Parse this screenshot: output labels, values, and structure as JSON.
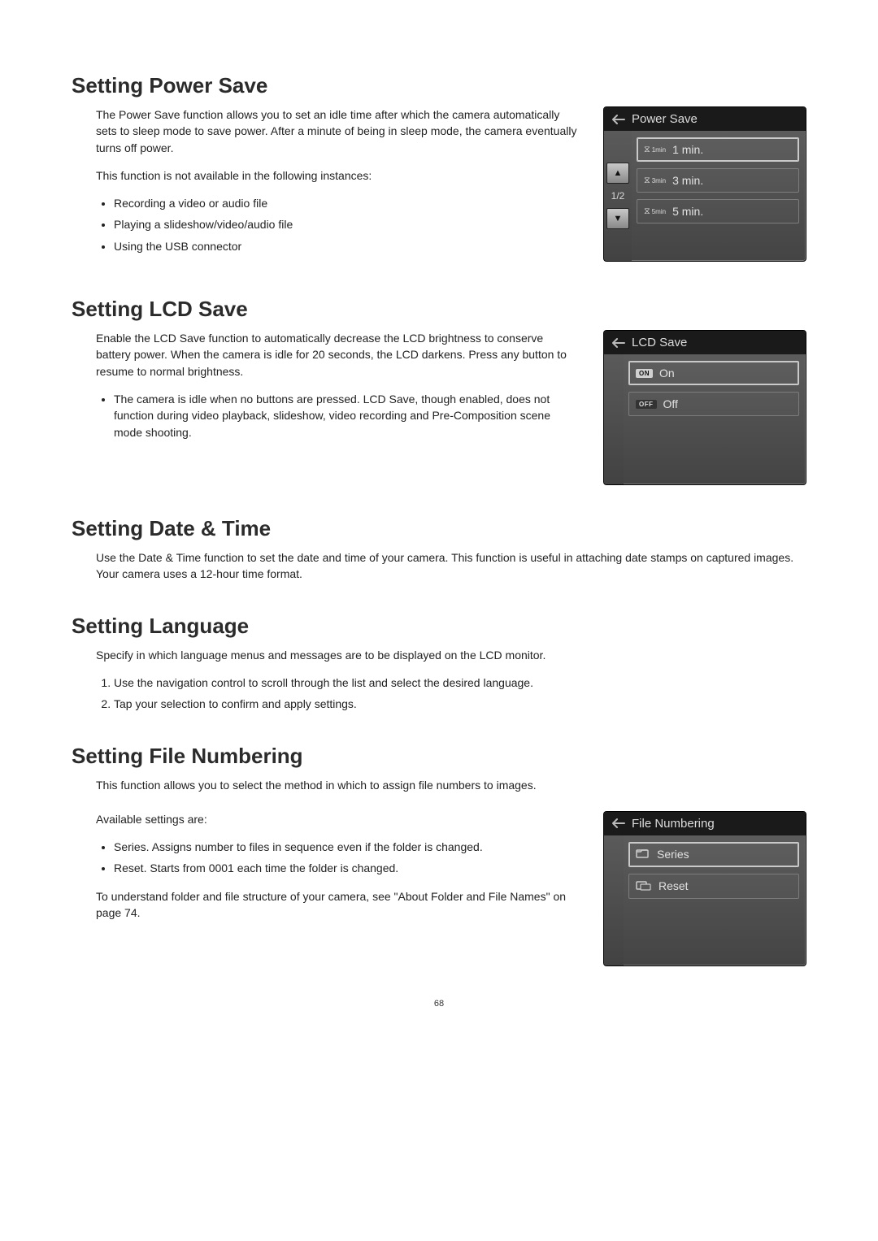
{
  "page_number": "68",
  "sections": {
    "power_save": {
      "heading": "Setting Power Save",
      "p1": "The Power Save function allows you to set an idle time after which the camera automatically sets to sleep mode to save power.  After a minute of being in sleep mode, the camera eventually turns off power.",
      "p2": "This function is not available in the following instances:",
      "bullets": [
        "Recording a video or audio file",
        "Playing a slideshow/video/audio file",
        "Using the USB connector"
      ],
      "lcd": {
        "title": "Power Save",
        "page_indicator": "1/2",
        "items": [
          {
            "icon": "1min",
            "label": "1 min."
          },
          {
            "icon": "3min",
            "label": "3 min."
          },
          {
            "icon": "5min",
            "label": "5 min."
          }
        ]
      }
    },
    "lcd_save": {
      "heading": "Setting LCD Save",
      "p1": "Enable the LCD Save function to automatically decrease the LCD brightness to conserve battery power.  When the camera is idle for 20 seconds, the LCD darkens.  Press any button to resume to normal brightness.",
      "bullets": [
        "The camera is idle when no buttons are pressed. LCD Save, though enabled, does not function during video playback, slideshow, video recording and Pre-Composition scene mode shooting."
      ],
      "lcd": {
        "title": "LCD Save",
        "items": [
          {
            "badge": "ON",
            "label": "On"
          },
          {
            "badge": "OFF",
            "label": "Off"
          }
        ]
      }
    },
    "date_time": {
      "heading": "Setting Date & Time",
      "p1": "Use the Date & Time function to set the date and time of your camera. This function is useful in attaching date stamps on captured images. Your camera uses a 12-hour time format."
    },
    "language": {
      "heading": "Setting Language",
      "p1": "Specify in which language menus and messages are to be displayed on the LCD monitor.",
      "steps": [
        "Use the navigation control to scroll through the list and select the desired language.",
        "Tap your selection to confirm and apply settings."
      ]
    },
    "file_numbering": {
      "heading": "Setting File Numbering",
      "p1": "This function allows you to select the method in which to assign file numbers to images.",
      "p2": "Available settings are:",
      "bullets": [
        "Series. Assigns number to files in sequence even if the folder is changed.",
        "Reset. Starts from 0001 each time the folder is changed."
      ],
      "p3": "To understand folder and file structure of your camera, see \"About Folder and File Names\" on page 74.",
      "lcd": {
        "title": "File Numbering",
        "items": [
          {
            "label": "Series"
          },
          {
            "label": "Reset"
          }
        ]
      }
    }
  }
}
